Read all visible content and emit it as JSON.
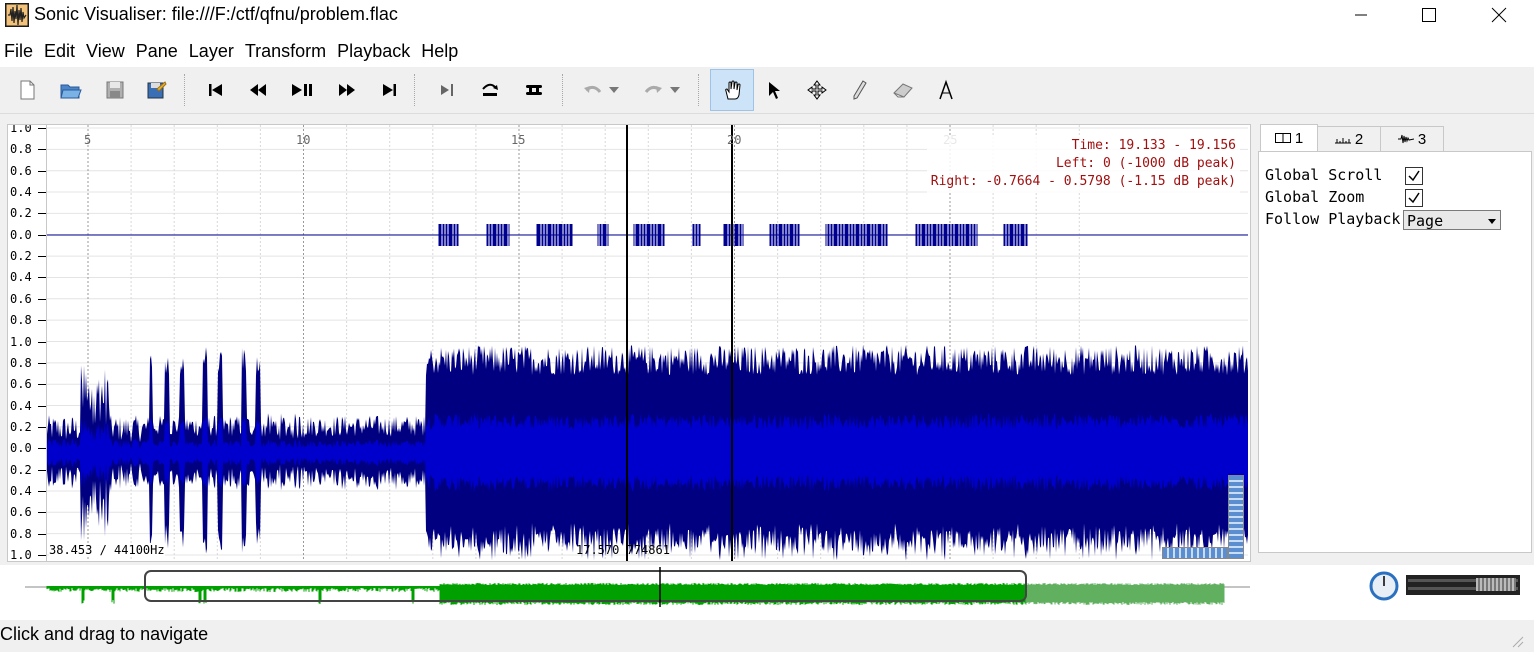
{
  "window": {
    "title": "Sonic Visualiser: file:///F:/ctf/qfnu/problem.flac",
    "minimize_icon": "minimize-icon",
    "maximize_icon": "maximize-icon",
    "close_icon": "close-icon"
  },
  "menu": [
    "File",
    "Edit",
    "View",
    "Pane",
    "Layer",
    "Transform",
    "Playback",
    "Help"
  ],
  "toolbar": {
    "icons": [
      "new-file-icon",
      "open-folder-icon",
      "save-icon",
      "save-session-icon",
      "rewind-start-icon",
      "rewind-icon",
      "play-pause-icon",
      "fast-forward-icon",
      "fast-forward-end-icon",
      "play-selection-icon",
      "loop-icon",
      "solo-icon",
      "undo-icon",
      "undo-dropdown-icon",
      "redo-icon",
      "redo-dropdown-icon",
      "navigate-hand-icon",
      "select-arrow-icon",
      "move-icon",
      "draw-pencil-icon",
      "erase-icon",
      "measure-icon"
    ],
    "active_tool": "navigate-hand-icon"
  },
  "pane": {
    "time_ticks": [
      "5",
      "10",
      "15",
      "20",
      "25"
    ],
    "ruler_labels": [
      "1.0",
      "0.8",
      "0.6",
      "0.4",
      "0.2",
      "0.0",
      "0.2",
      "0.4",
      "0.6",
      "0.8",
      "1.0",
      "0.8",
      "0.6",
      "0.4",
      "0.2",
      "0.0",
      "0.2",
      "0.4",
      "0.6",
      "0.8",
      "1.0"
    ],
    "info_time": "Time: 19.133 - 19.156",
    "info_left": "Left: 0 (-1000 dB peak)",
    "info_right": "Right: -0.7664 - 0.5798 (-1.15 dB peak)",
    "duration_text": "38.453 / 44100Hz",
    "position_text": "17.570 774861",
    "top_channel_color": "#000090",
    "bottom_channel_color": "#0000cc",
    "bottom_channel_dark": "#000080"
  },
  "properties": {
    "tabs": [
      {
        "label": "1",
        "icon": "pane-icon"
      },
      {
        "label": "2",
        "icon": "ruler-icon"
      },
      {
        "label": "3",
        "icon": "waveform-icon"
      }
    ],
    "global_scroll_label": "Global Scroll",
    "global_scroll_checked": true,
    "global_zoom_label": "Global Zoom",
    "global_zoom_checked": true,
    "follow_playback_label": "Follow Playback",
    "follow_playback_value": "Page"
  },
  "overview": {
    "color": "#00a000",
    "light_color": "#60b060"
  },
  "status": {
    "text": "Click and drag to navigate"
  }
}
